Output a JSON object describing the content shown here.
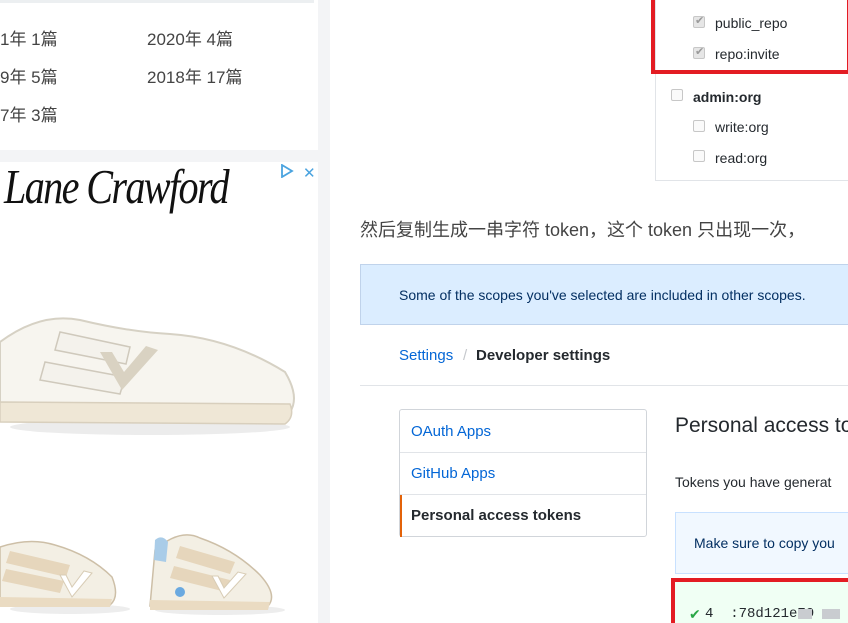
{
  "sidebar": {
    "archive": [
      {
        "label": "1年  1篇"
      },
      {
        "label": "2020年  4篇"
      },
      {
        "label": "9年  5篇"
      },
      {
        "label": "2018年  17篇"
      },
      {
        "label": "7年  3篇"
      }
    ],
    "ad": {
      "brand": "Lane Crawford",
      "ad_choices_icon": "ad-choices-icon",
      "close_icon": "close-icon",
      "close_glyph": "✕"
    }
  },
  "scopes": [
    {
      "label": "public_repo",
      "checked": true
    },
    {
      "label": "repo:invite",
      "checked": true
    },
    {
      "label": "admin:org",
      "checked": false,
      "bold": true
    },
    {
      "label": "write:org",
      "checked": false
    },
    {
      "label": "read:org",
      "checked": false
    }
  ],
  "article": {
    "paragraph": "然后复制生成一串字符 token，这个 token 只出现一次，",
    "flash_message": "Some of the scopes you've selected are included in other scopes."
  },
  "breadcrumb": {
    "link": "Settings",
    "separator": "/",
    "current": "Developer settings"
  },
  "settings_menu": [
    {
      "label": "OAuth Apps"
    },
    {
      "label": "GitHub Apps"
    },
    {
      "label": "Personal access tokens"
    }
  ],
  "tokens_section": {
    "heading": "Personal access to",
    "description": "Tokens you have generat",
    "notice": "Make sure to copy you",
    "token_value": "4  :78d121e79"
  },
  "colors": {
    "highlight_border": "#e31c23",
    "link": "#0366d6",
    "flash_bg": "#dbedff",
    "success": "#28a745"
  }
}
